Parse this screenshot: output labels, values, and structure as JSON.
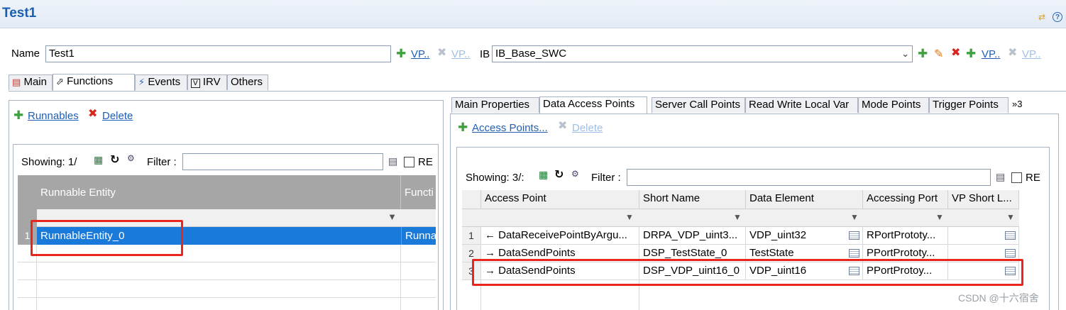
{
  "header": {
    "title": "Test1"
  },
  "toolbar": {
    "name_label": "Name",
    "name_value": "Test1",
    "vp_link": "VP..",
    "vp_link_disabled": "VP..",
    "ib_label": "IB",
    "ib_value": "IB_Base_SWC",
    "vp_link2": "VP..",
    "vp_link2_disabled": "VP.."
  },
  "main_tabs": [
    "Main",
    "Functions",
    "Events",
    "IRV",
    "Others"
  ],
  "left_panel": {
    "runnables_link": "Runnables",
    "delete_link": "Delete",
    "showing": "Showing: 1/",
    "filter_label": "Filter :",
    "re_label": "RE",
    "columns": [
      "Runnable Entity",
      "Functi"
    ],
    "rows": [
      {
        "num": "1",
        "entity": "RunnableEntity_0",
        "func": "Runna"
      }
    ]
  },
  "right_tabs": [
    "Main Properties",
    "Data Access Points",
    "Server Call Points",
    "Read Write Local Var",
    "Mode Points",
    "Trigger Points",
    "»3"
  ],
  "right_panel": {
    "access_points_link": "Access Points...",
    "delete_link": "Delete",
    "showing": "Showing: 3/:",
    "filter_label": "Filter :",
    "re_label": "RE",
    "columns": [
      "Access Point",
      "Short Name",
      "Data Element",
      "Accessing Port",
      "VP Short L..."
    ],
    "rows": [
      {
        "num": "1",
        "arrow": "←",
        "access": "DataReceivePointByArgu...",
        "short": "DRPA_VDP_uint3...",
        "element": "VDP_uint32",
        "port": "RPortPrototy..."
      },
      {
        "num": "2",
        "arrow": "→",
        "access": "DataSendPoints",
        "short": "DSP_TestState_0",
        "element": "TestState",
        "port": "PPortPrototy..."
      },
      {
        "num": "3",
        "arrow": "→",
        "access": "DataSendPoints",
        "short": "DSP_VDP_uint16_0",
        "element": "VDP_uint16",
        "port": "PPortProtoy..."
      }
    ]
  },
  "watermark": "CSDN @十六宿舍",
  "colors": {
    "accent": "#1b5fae",
    "selection": "#1a7ad9",
    "highlight": "#e8261e",
    "grid_header": "#a6a6a6"
  }
}
